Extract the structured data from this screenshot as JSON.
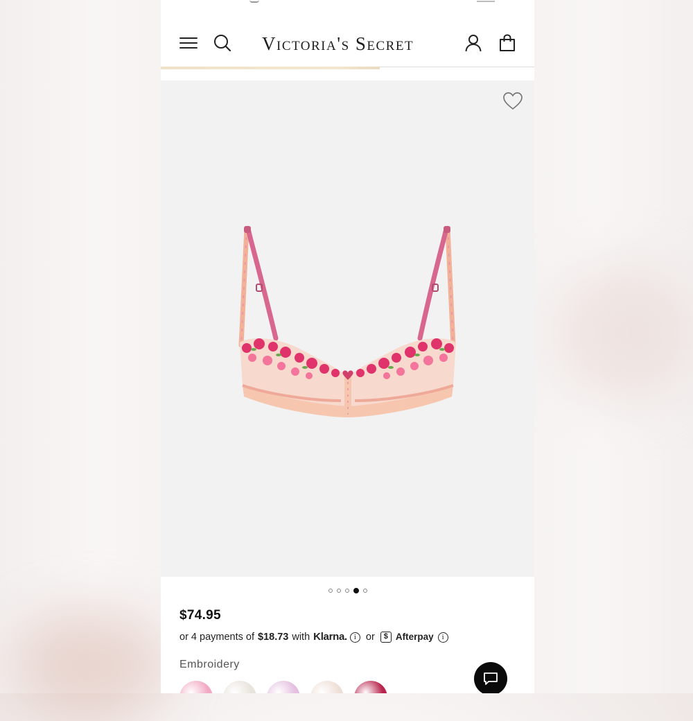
{
  "header": {
    "brand": "Victoria's Secret"
  },
  "product": {
    "price": "$74.95",
    "gallery_count": 5,
    "gallery_active_index": 3,
    "payments": {
      "prefix": "or 4 payments of",
      "amount": "$18.73",
      "with": "with",
      "klarna": "Klarna.",
      "or": "or",
      "afterpay_symbol": "$",
      "afterpay": "Afterpay",
      "info": "i"
    },
    "variant_label": "Embroidery",
    "swatches": [
      {
        "name": "pink-floral",
        "color": "#f2a9c3"
      },
      {
        "name": "ivory-lace",
        "color": "#e8e3dc"
      },
      {
        "name": "lilac-floral",
        "color": "#e4bfe0"
      },
      {
        "name": "pastel-blue",
        "color": "#eedfd6"
      },
      {
        "name": "berry-floral",
        "color": "#b8244d"
      }
    ]
  },
  "icons": {
    "menu": "hamburger-icon",
    "search": "search-icon",
    "account": "account-icon",
    "bag": "shopping-bag-icon",
    "wishlist": "heart-icon",
    "chat": "chat-icon"
  },
  "colors": {
    "image_bg": "#f2f2f2",
    "text": "#111111",
    "strap_pink": "#d8678f",
    "band_peach": "#f6c7ae"
  }
}
